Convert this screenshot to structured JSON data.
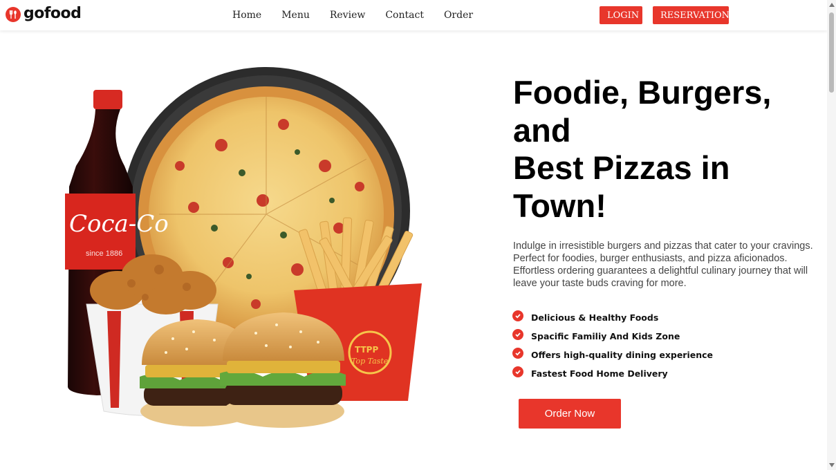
{
  "brand": {
    "name": "gofood",
    "icon": "fork-spoon-icon",
    "accent_color": "#e8362b"
  },
  "nav": {
    "links": [
      {
        "label": "Home"
      },
      {
        "label": "Menu"
      },
      {
        "label": "Review"
      },
      {
        "label": "Contact"
      },
      {
        "label": "Order"
      }
    ],
    "login_label": "LOGIN",
    "reservation_label": "RESERVATION"
  },
  "hero": {
    "title_line1": "Foodie, Burgers,",
    "title_line2": "and",
    "title_line3": "Best Pizzas in",
    "title_line4": "Town!",
    "description": "Indulge in irresistible burgers and pizzas that cater to your cravings. Perfect for foodies, burger enthusiasts, and pizza aficionados. Effortless ordering guarantees a delightful culinary journey that will leave your taste buds craving for more.",
    "features": [
      {
        "text": "Delicious & Healthy Foods"
      },
      {
        "text": "Spacific Familiy And Kids Zone"
      },
      {
        "text": "Offers high-quality dining experience"
      },
      {
        "text": "Fastest Food Home Delivery"
      }
    ],
    "cta_label": "Order Now",
    "image": {
      "bottle_label": "Coca-Cola",
      "bottle_sub": "since 1886",
      "fries_label": "TTPP",
      "fries_sub": "Top Taste"
    }
  }
}
